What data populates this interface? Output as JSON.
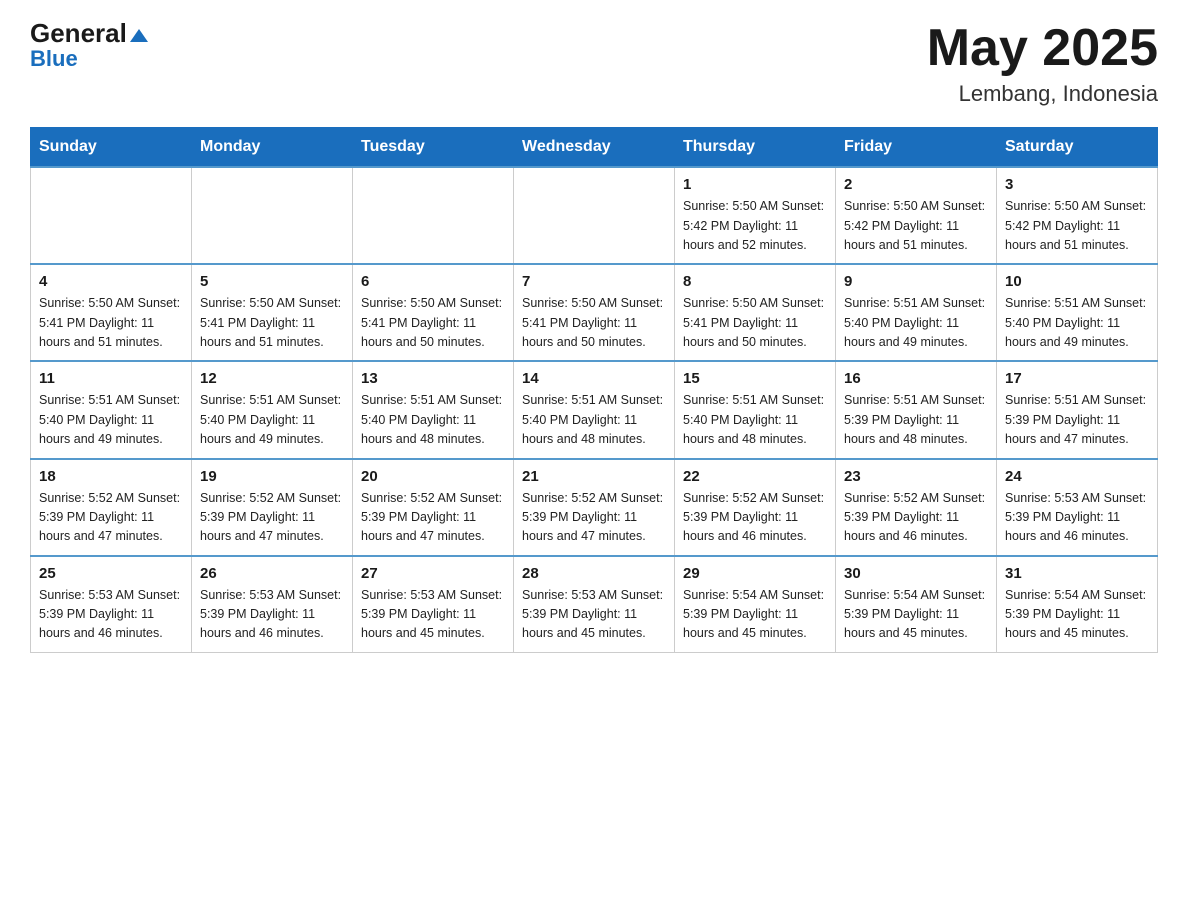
{
  "header": {
    "logo_general": "General",
    "logo_blue": "Blue",
    "month_year": "May 2025",
    "location": "Lembang, Indonesia"
  },
  "days_of_week": [
    "Sunday",
    "Monday",
    "Tuesday",
    "Wednesday",
    "Thursday",
    "Friday",
    "Saturday"
  ],
  "weeks": [
    [
      {
        "day": "",
        "info": ""
      },
      {
        "day": "",
        "info": ""
      },
      {
        "day": "",
        "info": ""
      },
      {
        "day": "",
        "info": ""
      },
      {
        "day": "1",
        "info": "Sunrise: 5:50 AM\nSunset: 5:42 PM\nDaylight: 11 hours\nand 52 minutes."
      },
      {
        "day": "2",
        "info": "Sunrise: 5:50 AM\nSunset: 5:42 PM\nDaylight: 11 hours\nand 51 minutes."
      },
      {
        "day": "3",
        "info": "Sunrise: 5:50 AM\nSunset: 5:42 PM\nDaylight: 11 hours\nand 51 minutes."
      }
    ],
    [
      {
        "day": "4",
        "info": "Sunrise: 5:50 AM\nSunset: 5:41 PM\nDaylight: 11 hours\nand 51 minutes."
      },
      {
        "day": "5",
        "info": "Sunrise: 5:50 AM\nSunset: 5:41 PM\nDaylight: 11 hours\nand 51 minutes."
      },
      {
        "day": "6",
        "info": "Sunrise: 5:50 AM\nSunset: 5:41 PM\nDaylight: 11 hours\nand 50 minutes."
      },
      {
        "day": "7",
        "info": "Sunrise: 5:50 AM\nSunset: 5:41 PM\nDaylight: 11 hours\nand 50 minutes."
      },
      {
        "day": "8",
        "info": "Sunrise: 5:50 AM\nSunset: 5:41 PM\nDaylight: 11 hours\nand 50 minutes."
      },
      {
        "day": "9",
        "info": "Sunrise: 5:51 AM\nSunset: 5:40 PM\nDaylight: 11 hours\nand 49 minutes."
      },
      {
        "day": "10",
        "info": "Sunrise: 5:51 AM\nSunset: 5:40 PM\nDaylight: 11 hours\nand 49 minutes."
      }
    ],
    [
      {
        "day": "11",
        "info": "Sunrise: 5:51 AM\nSunset: 5:40 PM\nDaylight: 11 hours\nand 49 minutes."
      },
      {
        "day": "12",
        "info": "Sunrise: 5:51 AM\nSunset: 5:40 PM\nDaylight: 11 hours\nand 49 minutes."
      },
      {
        "day": "13",
        "info": "Sunrise: 5:51 AM\nSunset: 5:40 PM\nDaylight: 11 hours\nand 48 minutes."
      },
      {
        "day": "14",
        "info": "Sunrise: 5:51 AM\nSunset: 5:40 PM\nDaylight: 11 hours\nand 48 minutes."
      },
      {
        "day": "15",
        "info": "Sunrise: 5:51 AM\nSunset: 5:40 PM\nDaylight: 11 hours\nand 48 minutes."
      },
      {
        "day": "16",
        "info": "Sunrise: 5:51 AM\nSunset: 5:39 PM\nDaylight: 11 hours\nand 48 minutes."
      },
      {
        "day": "17",
        "info": "Sunrise: 5:51 AM\nSunset: 5:39 PM\nDaylight: 11 hours\nand 47 minutes."
      }
    ],
    [
      {
        "day": "18",
        "info": "Sunrise: 5:52 AM\nSunset: 5:39 PM\nDaylight: 11 hours\nand 47 minutes."
      },
      {
        "day": "19",
        "info": "Sunrise: 5:52 AM\nSunset: 5:39 PM\nDaylight: 11 hours\nand 47 minutes."
      },
      {
        "day": "20",
        "info": "Sunrise: 5:52 AM\nSunset: 5:39 PM\nDaylight: 11 hours\nand 47 minutes."
      },
      {
        "day": "21",
        "info": "Sunrise: 5:52 AM\nSunset: 5:39 PM\nDaylight: 11 hours\nand 47 minutes."
      },
      {
        "day": "22",
        "info": "Sunrise: 5:52 AM\nSunset: 5:39 PM\nDaylight: 11 hours\nand 46 minutes."
      },
      {
        "day": "23",
        "info": "Sunrise: 5:52 AM\nSunset: 5:39 PM\nDaylight: 11 hours\nand 46 minutes."
      },
      {
        "day": "24",
        "info": "Sunrise: 5:53 AM\nSunset: 5:39 PM\nDaylight: 11 hours\nand 46 minutes."
      }
    ],
    [
      {
        "day": "25",
        "info": "Sunrise: 5:53 AM\nSunset: 5:39 PM\nDaylight: 11 hours\nand 46 minutes."
      },
      {
        "day": "26",
        "info": "Sunrise: 5:53 AM\nSunset: 5:39 PM\nDaylight: 11 hours\nand 46 minutes."
      },
      {
        "day": "27",
        "info": "Sunrise: 5:53 AM\nSunset: 5:39 PM\nDaylight: 11 hours\nand 45 minutes."
      },
      {
        "day": "28",
        "info": "Sunrise: 5:53 AM\nSunset: 5:39 PM\nDaylight: 11 hours\nand 45 minutes."
      },
      {
        "day": "29",
        "info": "Sunrise: 5:54 AM\nSunset: 5:39 PM\nDaylight: 11 hours\nand 45 minutes."
      },
      {
        "day": "30",
        "info": "Sunrise: 5:54 AM\nSunset: 5:39 PM\nDaylight: 11 hours\nand 45 minutes."
      },
      {
        "day": "31",
        "info": "Sunrise: 5:54 AM\nSunset: 5:39 PM\nDaylight: 11 hours\nand 45 minutes."
      }
    ]
  ]
}
